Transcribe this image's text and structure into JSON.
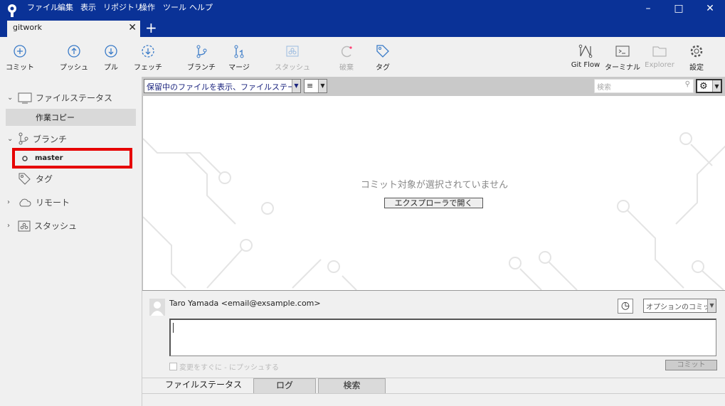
{
  "menu": [
    "ファイル",
    "編集",
    "表示",
    "リポジトリ",
    "操作",
    "ツール",
    "ヘルプ"
  ],
  "tab": {
    "title": "gitwork"
  },
  "toolbar": {
    "commit": "コミット",
    "push": "プッシュ",
    "pull": "プル",
    "fetch": "フェッチ",
    "branch": "ブランチ",
    "merge": "マージ",
    "stash": "スタッシュ",
    "discard": "破棄",
    "tag": "タグ",
    "gitflow": "Git Flow",
    "terminal": "ターミナル",
    "explorer": "Explorer",
    "settings": "設定"
  },
  "sidebar": {
    "file_status": "ファイルステータス",
    "working_copy": "作業コピー",
    "branches": "ブランチ",
    "master": "master",
    "tags": "タグ",
    "remotes": "リモート",
    "stashes": "スタッシュ"
  },
  "filter": {
    "selected": "保留中のファイルを表示、ファイルステータス順",
    "search_placeholder": "検索"
  },
  "main": {
    "empty": "コミット対象が選択されていません",
    "open_explorer": "エクスプローラで開く"
  },
  "commit": {
    "author": "Taro Yamada <email@exsample.com>",
    "options": "オプションのコミット",
    "push_label": "変更をすぐに - にプッシュする",
    "commit_button": "コミット"
  },
  "bottom_tabs": [
    "ファイルステータス",
    "ログ",
    "検索"
  ],
  "colors": {
    "titlebar": "#0a3297",
    "highlight": "#e60000",
    "icon": "#3a7bc8"
  }
}
